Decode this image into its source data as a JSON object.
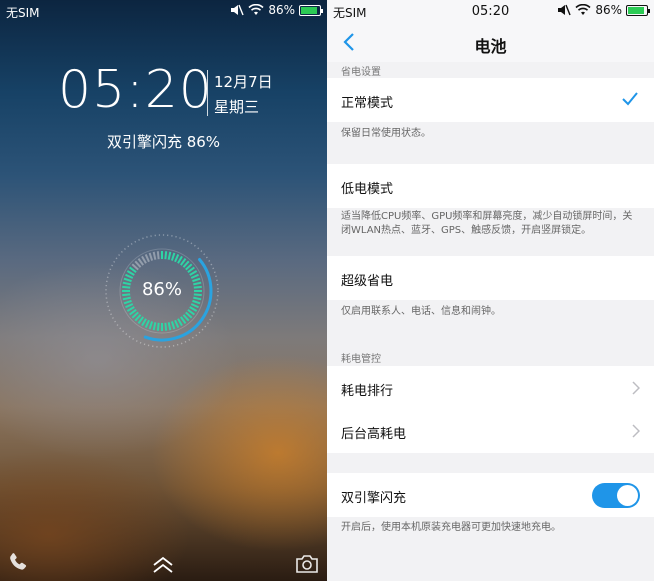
{
  "lock_screen": {
    "carrier": "无SIM",
    "battery_percent_label": "86%",
    "time": "05:20",
    "date": "12月7日",
    "weekday": "星期三",
    "charging_text": "双引擎闪充 86%",
    "ring_label": "86%",
    "battery_level": 0.86,
    "icons": [
      "mute-icon",
      "wifi-icon",
      "battery-icon",
      "phone-icon",
      "swipe-up-icon",
      "camera-icon"
    ],
    "colors": {
      "ring_teal": "#2fd4a5",
      "ring_blue": "#2aa3e0",
      "battery_green": "#2ccb55"
    }
  },
  "settings": {
    "status": {
      "carrier": "无SIM",
      "time": "05:20",
      "battery_percent_label": "86%"
    },
    "nav": {
      "title": "电池"
    },
    "power_section": {
      "header": "省电设置",
      "normal_mode": {
        "label": "正常模式",
        "desc": "保留日常使用状态。",
        "selected": true
      },
      "low_power_mode": {
        "label": "低电模式",
        "desc": "适当降低CPU频率、GPU频率和屏幕亮度，减少自动锁屏时间，关闭WLAN热点、蓝牙、GPS、触感反馈，开启竖屏锁定。"
      },
      "super_saver": {
        "label": "超级省电",
        "desc": "仅启用联系人、电话、信息和闹钟。"
      }
    },
    "consumption_section": {
      "header": "耗电管控",
      "ranking_label": "耗电排行",
      "background_label": "后台高耗电"
    },
    "fast_charge": {
      "label": "双引擎闪充",
      "desc": "开启后，使用本机原装充电器可更加快速地充电。",
      "enabled": true
    },
    "colors": {
      "accent": "#1f95e8",
      "background": "#f2f2f4"
    }
  }
}
